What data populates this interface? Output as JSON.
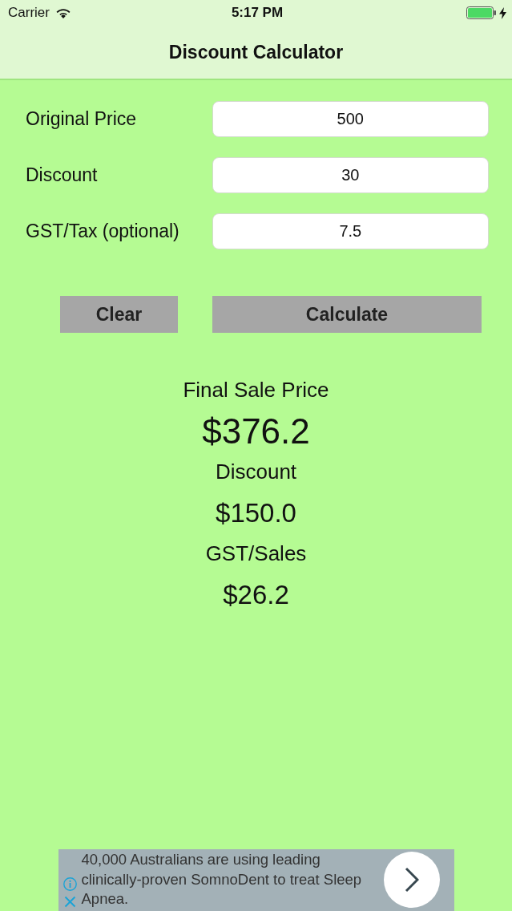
{
  "status_bar": {
    "carrier": "Carrier",
    "time": "5:17 PM"
  },
  "nav_bar": {
    "title": "Discount Calculator"
  },
  "fields": [
    {
      "label": "Original Price",
      "value": "500"
    },
    {
      "label": "Discount",
      "value": "30"
    },
    {
      "label": "GST/Tax (optional)",
      "value": "7.5"
    }
  ],
  "buttons": [
    {
      "kind": "clear",
      "label": "Clear"
    },
    {
      "kind": "calculate",
      "label": "Calculate"
    }
  ],
  "results": [
    {
      "kind": "label",
      "text": "Final Sale Price"
    },
    {
      "kind": "total",
      "text": "$376.2"
    },
    {
      "kind": "label",
      "text": "Discount"
    },
    {
      "kind": "amount",
      "text": "$150.0"
    },
    {
      "kind": "label",
      "text": "GST/Sales"
    },
    {
      "kind": "amount",
      "text": "$26.2"
    }
  ],
  "ad_banner": {
    "text": "40,000 Australians are using leading clinically-proven SomnoDent to treat Sleep Apnea."
  }
}
